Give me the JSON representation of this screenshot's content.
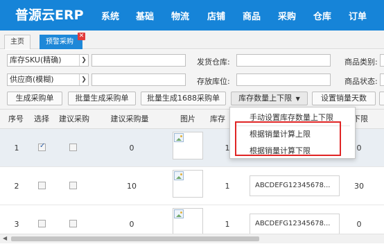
{
  "app": {
    "brand": "普源云ERP"
  },
  "nav": [
    "系统",
    "基础",
    "物流",
    "店铺",
    "商品",
    "采购",
    "仓库",
    "订单"
  ],
  "tabs": [
    {
      "label": "主页",
      "active": false
    },
    {
      "label": "预警采购",
      "active": true
    }
  ],
  "filters": {
    "sku_mode": "库存SKU(精确)",
    "supplier_mode": "供应商(模糊)",
    "ship_warehouse_label": "发货仓库:",
    "storage_location_label": "存放库位:",
    "product_category_label": "商品类别:",
    "product_status_label": "商品状态:",
    "sku_value": "",
    "supplier_value": "",
    "ship_warehouse_value": "",
    "storage_location_value": ""
  },
  "buttons": {
    "generate_po": "生成采购单",
    "batch_generate_po": "批量生成采购单",
    "batch_generate_1688": "批量生成1688采购单",
    "stock_limits": "库存数量上下限",
    "set_sales_days": "设置销量天数"
  },
  "dropdown": {
    "items": [
      "手动设置库存数量上下限",
      "根据销量计算上限",
      "根据销量计算下限"
    ]
  },
  "table": {
    "headers": [
      "序号",
      "选择",
      "建议采购",
      "建议采购量",
      "图片",
      "库存",
      "",
      "下限"
    ],
    "rows": [
      {
        "index": "1",
        "selected": true,
        "suggest": false,
        "qty": "0",
        "stock": "1",
        "sku": "",
        "lower": "0"
      },
      {
        "index": "2",
        "selected": false,
        "suggest": false,
        "qty": "10",
        "stock": "1",
        "sku": "ABCDEFG12345678...",
        "lower": "30"
      },
      {
        "index": "3",
        "selected": false,
        "suggest": false,
        "qty": "0",
        "stock": "1",
        "sku": "ABCDEFG12345678...",
        "lower": "0"
      }
    ]
  },
  "colors": {
    "nav_bg": "#1684d8",
    "active_tab": "#1e88d8",
    "highlight": "#e02424",
    "close": "#e23b3b"
  }
}
